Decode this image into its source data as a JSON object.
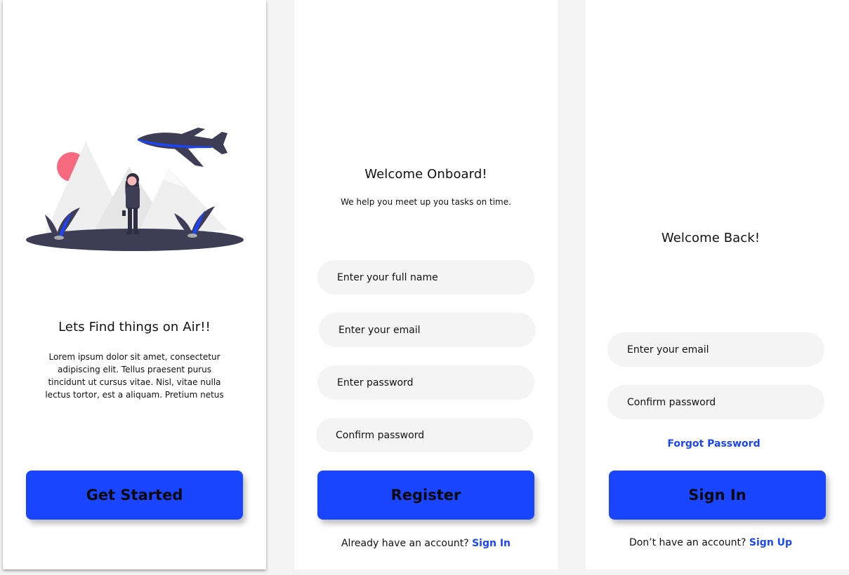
{
  "onboarding": {
    "title": "Lets Find things on Air!!",
    "body": "Lorem ipsum dolor sit amet, consectetur adipiscing elit. Tellus praesent purus tincidunt ut cursus vitae. Nisl, vitae nulla lectus tortor, est a aliquam. Pretium netus",
    "button_label": "Get Started",
    "illustration_icon": "travel-illustration",
    "colors": {
      "accent": "#1a45ff",
      "sun": "#f7697e",
      "ground": "#3f3d56"
    }
  },
  "register": {
    "title": "Welcome Onboard!",
    "subtitle": "We help you meet up you tasks on time.",
    "fields": {
      "full_name_placeholder": "Enter your full name",
      "email_placeholder": "Enter your email",
      "password_placeholder": "Enter password",
      "confirm_password_placeholder": "Confirm password"
    },
    "button_label": "Register",
    "footer_text": "Already have an account?",
    "footer_link": "Sign In"
  },
  "signin": {
    "title": "Welcome Back!",
    "fields": {
      "email_placeholder": "Enter your email",
      "password_placeholder": "Confirm password"
    },
    "forgot_link": "Forgot Password",
    "button_label": "Sign In",
    "footer_text": "Don’t have an account?",
    "footer_link": "Sign Up"
  }
}
